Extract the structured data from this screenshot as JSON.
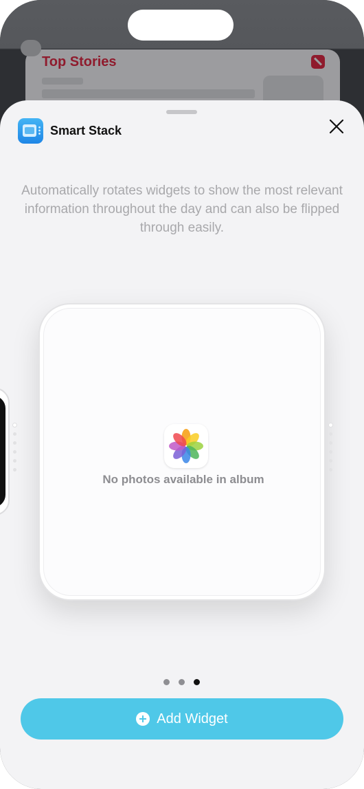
{
  "background": {
    "card_title": "Top Stories",
    "card_icon": "news-icon"
  },
  "sheet": {
    "title": "Smart Stack",
    "app_icon": "smart-stack-icon",
    "close_icon": "close-icon",
    "description": "Automatically rotates widgets to show the most relevant information throughout the day and can also be flipped through easily."
  },
  "widget": {
    "icon": "photos-icon",
    "empty_message": "No photos available in album"
  },
  "pager": {
    "page_count": 3,
    "current_page": 3
  },
  "stack_indicator": {
    "item_count": 6,
    "active_index": 1
  },
  "add_button": {
    "icon": "plus-circle-icon",
    "label": "Add Widget"
  },
  "colors": {
    "accent": "#4fc8e8",
    "sheet_background": "#f3f3f5",
    "news_red": "#8f1b2d"
  }
}
